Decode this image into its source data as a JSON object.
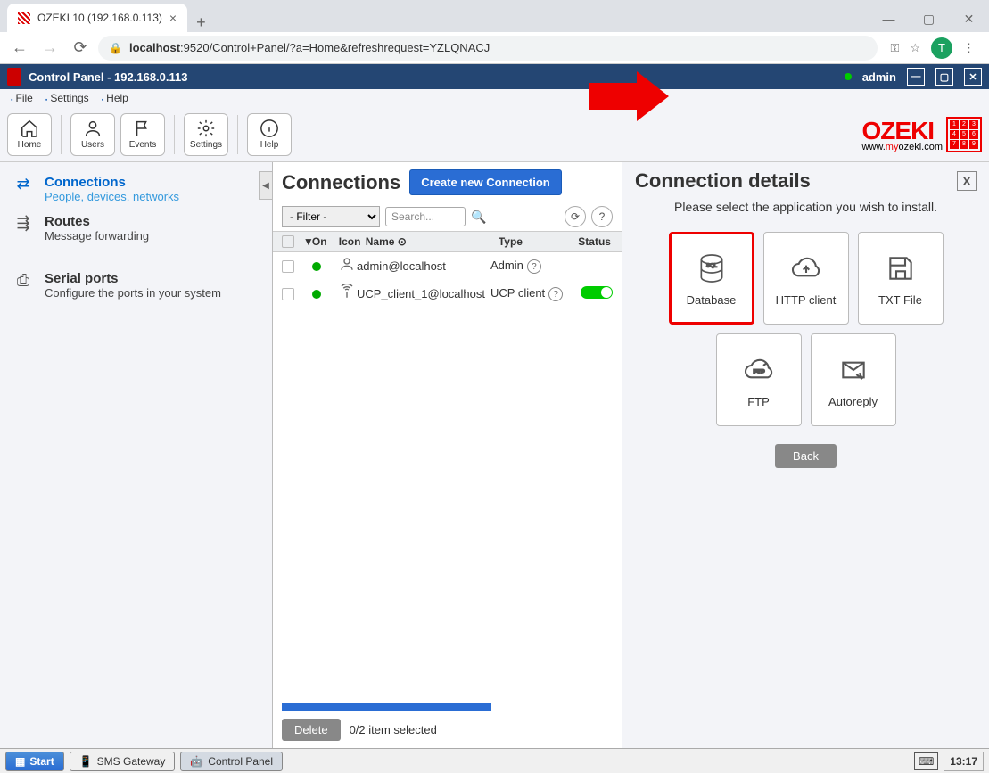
{
  "browser": {
    "tab_title": "OZEKI 10 (192.168.0.113)",
    "url_host": "localhost",
    "url_path": ":9520/Control+Panel/?a=Home&refreshrequest=YZLQNACJ",
    "avatar_letter": "T"
  },
  "app_header": {
    "title": "Control Panel - 192.168.0.113",
    "user": "admin"
  },
  "menu": {
    "file": "File",
    "settings": "Settings",
    "help": "Help"
  },
  "toolbar": {
    "home": "Home",
    "users": "Users",
    "events": "Events",
    "settings": "Settings",
    "help": "Help"
  },
  "logo": {
    "brand": "OZEKI",
    "sub_pre": "www.",
    "sub_mid": "my",
    "sub_post": "ozeki.com"
  },
  "sidebar": {
    "items": [
      {
        "title": "Connections",
        "sub": "People, devices, networks"
      },
      {
        "title": "Routes",
        "sub": "Message forwarding"
      },
      {
        "title": "Serial ports",
        "sub": "Configure the ports in your system"
      }
    ]
  },
  "connections": {
    "title": "Connections",
    "create": "Create new Connection",
    "filter_label": "- Filter -",
    "search_placeholder": "Search...",
    "columns": {
      "on": "On",
      "icon": "Icon",
      "name": "Name",
      "type": "Type",
      "status": "Status"
    },
    "rows": [
      {
        "name": "admin@localhost",
        "type": "Admin"
      },
      {
        "name": "UCP_client_1@localhost",
        "type": "UCP client"
      }
    ],
    "delete": "Delete",
    "selected": "0/2 item selected"
  },
  "details": {
    "title": "Connection details",
    "message": "Please select the application you wish to install.",
    "tiles": [
      {
        "label": "Database"
      },
      {
        "label": "HTTP client"
      },
      {
        "label": "TXT File"
      },
      {
        "label": "FTP"
      },
      {
        "label": "Autoreply"
      }
    ],
    "back": "Back"
  },
  "taskbar": {
    "start": "Start",
    "sms": "SMS Gateway",
    "control": "Control Panel",
    "time": "13:17"
  }
}
